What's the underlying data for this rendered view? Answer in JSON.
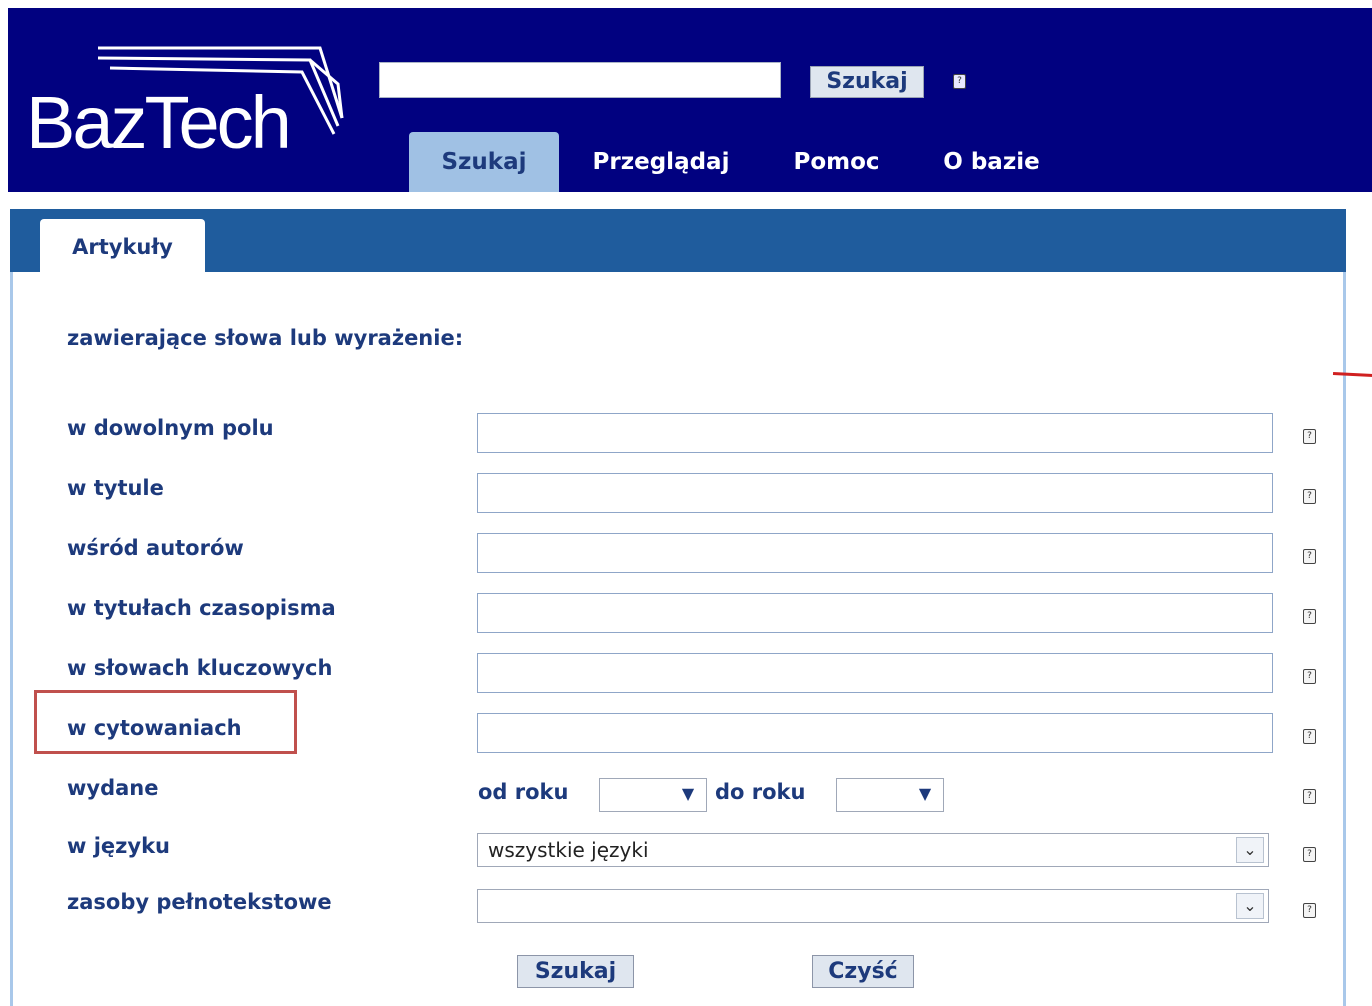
{
  "header": {
    "logo_text": "BazTech",
    "search_placeholder": "",
    "search_button": "Szukaj",
    "nav": [
      {
        "label": "Szukaj",
        "active": true
      },
      {
        "label": "Przeglądaj",
        "active": false
      },
      {
        "label": "Pomoc",
        "active": false
      },
      {
        "label": "O bazie",
        "active": false
      }
    ]
  },
  "panel": {
    "tab": "Artykuły",
    "heading": "zawierające słowa lub wyrażenie:",
    "fields": [
      {
        "label": "w dowolnym polu",
        "value": ""
      },
      {
        "label": "w tytule",
        "value": ""
      },
      {
        "label": "wśród autorów",
        "value": ""
      },
      {
        "label": "w tytułach czasopisma",
        "value": ""
      },
      {
        "label": "w słowach kluczowych",
        "value": ""
      },
      {
        "label": "w cytowaniach",
        "value": ""
      }
    ],
    "published": {
      "label": "wydane",
      "from_label": "od roku",
      "to_label": "do roku",
      "from_value": "",
      "to_value": ""
    },
    "language": {
      "label": "w języku",
      "value": "wszystkie języki"
    },
    "fulltext": {
      "label": "zasoby pełnotekstowe",
      "value": ""
    },
    "search_button": "Szukaj",
    "clear_button": "Czyść",
    "help_glyph": "?"
  },
  "colors": {
    "header_bg": "#010180",
    "tab_bar": "#1f5c9d",
    "active_tab": "#a0c1e4",
    "label": "#1d3a7c",
    "highlight": "#c0504d"
  }
}
